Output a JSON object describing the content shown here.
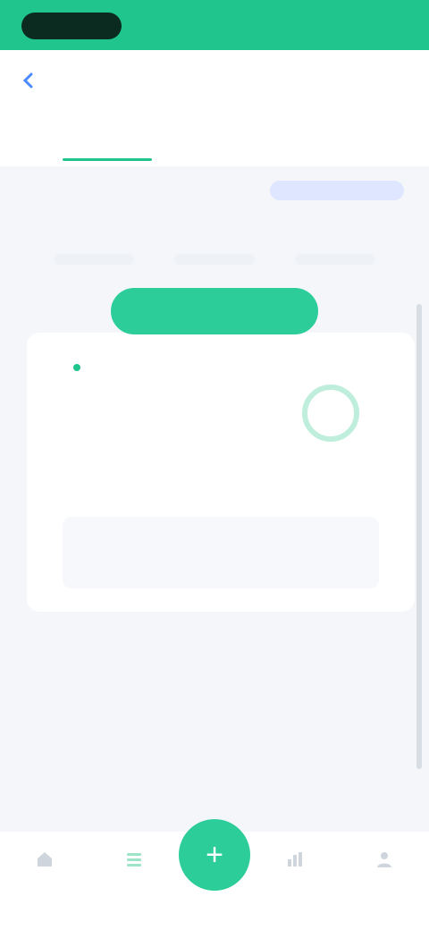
{
  "statusbar": {
    "left_text": "",
    "right_text": ""
  },
  "header": {
    "title": "",
    "more": ""
  },
  "tabs": [
    {
      "label": ""
    },
    {
      "label": ""
    }
  ],
  "subbar": {
    "label": "",
    "link": ""
  },
  "section": {
    "label": ""
  },
  "days": [
    {
      "label": ""
    },
    {
      "label": ""
    },
    {
      "label": ""
    }
  ],
  "cta": {
    "label": ""
  },
  "card": {
    "title": "",
    "stats": [
      {
        "value": "",
        "caption": ""
      },
      {
        "value": "",
        "caption": ""
      }
    ],
    "ring": {
      "value": "",
      "caption": ""
    },
    "note": ""
  },
  "blocks": {
    "title1": "",
    "title2": "",
    "row_text": "",
    "row_right": ""
  },
  "bottom_nav": [
    {
      "label": "",
      "icon": "home-icon"
    },
    {
      "label": "",
      "icon": "list-icon"
    },
    {
      "label": "",
      "icon": "plus-icon"
    },
    {
      "label": "",
      "icon": "chart-icon"
    },
    {
      "label": "",
      "icon": "user-icon"
    }
  ],
  "colors": {
    "primary": "#1fc58d",
    "cta": "#2ccd98",
    "background": "#f4f6f9",
    "link": "#5877ff"
  }
}
